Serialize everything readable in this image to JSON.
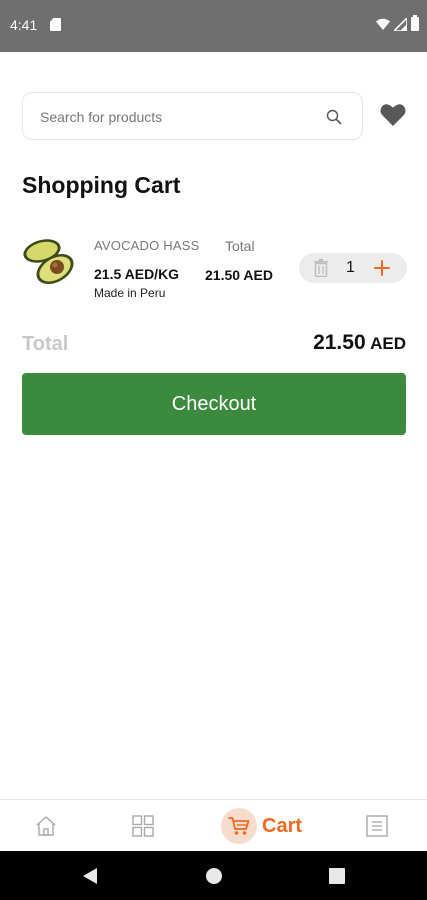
{
  "status_bar": {
    "time": "4:41"
  },
  "search": {
    "placeholder": "Search for products",
    "value": ""
  },
  "page": {
    "title": "Shopping Cart"
  },
  "cart_items": [
    {
      "name": "AVOCADO HASS",
      "price": "21.5 AED/KG",
      "origin": "Made in Peru",
      "total_label": "Total",
      "total_value": "21.50 AED",
      "quantity": "1"
    }
  ],
  "summary": {
    "total_label": "Total",
    "total_number": "21.50",
    "total_currency": "AED"
  },
  "checkout": {
    "label": "Checkout"
  },
  "bottom_nav": {
    "cart_label": "Cart"
  },
  "colors": {
    "accent": "#f06a1f",
    "checkout": "#3b8a3e",
    "status_bar": "#6f6f6f"
  },
  "icons": [
    "search-icon",
    "heart-icon",
    "trash-icon",
    "plus-icon",
    "home-icon",
    "categories-icon",
    "cart-icon",
    "orders-icon"
  ]
}
